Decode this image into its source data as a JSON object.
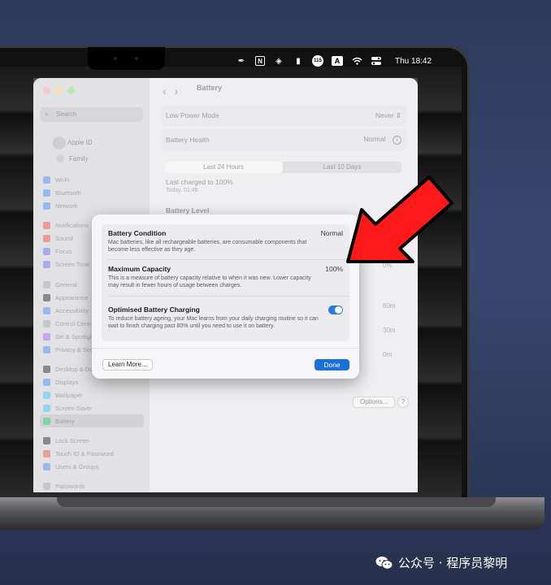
{
  "menubar": {
    "icons": [
      "pen-nib-icon",
      "notion-icon",
      "layers-icon",
      "mouse-icon",
      "badge-icon",
      "input-source-icon",
      "wifi-icon",
      "control-center-icon"
    ],
    "badge_text": "115",
    "input_source": "A",
    "notion_letter": "N",
    "clock": "Thu 18:42"
  },
  "sidebar": {
    "search_placeholder": "Search",
    "apple_id": "Apple ID",
    "family": "Family",
    "items": [
      {
        "label": "Wi-Fi",
        "color": "#3b82f6"
      },
      {
        "label": "Bluetooth",
        "color": "#3b82f6"
      },
      {
        "label": "Network",
        "color": "#3b82f6"
      },
      {
        "label": "Notifications",
        "color": "#ef4444"
      },
      {
        "label": "Sound",
        "color": "#ef4444"
      },
      {
        "label": "Focus",
        "color": "#6366f1"
      },
      {
        "label": "Screen Time",
        "color": "#6366f1"
      },
      {
        "label": "General",
        "color": "#9ca3af"
      },
      {
        "label": "Appearance",
        "color": "#111827"
      },
      {
        "label": "Accessibility",
        "color": "#3b82f6"
      },
      {
        "label": "Control Centre",
        "color": "#9ca3af"
      },
      {
        "label": "Siri & Spotlight",
        "color": "#a855f7"
      },
      {
        "label": "Privacy & Security",
        "color": "#3b82f6"
      },
      {
        "label": "Desktop & Dock",
        "color": "#111827"
      },
      {
        "label": "Displays",
        "color": "#3b82f6"
      },
      {
        "label": "Wallpaper",
        "color": "#38bdf8"
      },
      {
        "label": "Screen Saver",
        "color": "#38bdf8"
      },
      {
        "label": "Battery",
        "color": "#22c55e"
      },
      {
        "label": "Lock Screen",
        "color": "#111827"
      },
      {
        "label": "Touch ID & Password",
        "color": "#ef4444"
      },
      {
        "label": "Users & Groups",
        "color": "#3b82f6"
      },
      {
        "label": "Passwords",
        "color": "#9ca3af"
      }
    ],
    "active": "Battery"
  },
  "main": {
    "title": "Battery",
    "low_power_label": "Low Power Mode",
    "low_power_value": "Never",
    "health_label": "Battery Health",
    "health_value": "Normal",
    "tab_24h": "Last 24 Hours",
    "tab_10d": "Last 10 Days",
    "last_charged": "Last charged to 100%",
    "last_charged_time": "Today, 01:45",
    "battery_level": "Battery Level",
    "y_labels": [
      "0%",
      "60m",
      "30m",
      "0m"
    ],
    "options_label": "Options...",
    "help_label": "?"
  },
  "dialog": {
    "condition_title": "Battery Condition",
    "condition_value": "Normal",
    "condition_desc": "Mac batteries, like all rechargeable batteries, are consumable components that become less effective as they age.",
    "capacity_title": "Maximum Capacity",
    "capacity_value": "100%",
    "capacity_desc": "This is a measure of battery capacity relative to when it was new. Lower capacity may result in fewer hours of usage between charges.",
    "optimised_title": "Optimised Battery Charging",
    "optimised_desc": "To reduce battery ageing, your Mac learns from your daily charging routine so it can wait to finish charging past 80% until you need to use it on battery.",
    "optimised_on": true,
    "learn_more": "Learn More...",
    "done": "Done"
  },
  "watermark": "公众号 · 程序员黎明",
  "colors": {
    "accent": "#1a6fd9",
    "arrow": "#ff1a1a",
    "toggle_on": "#2a7ae2"
  }
}
